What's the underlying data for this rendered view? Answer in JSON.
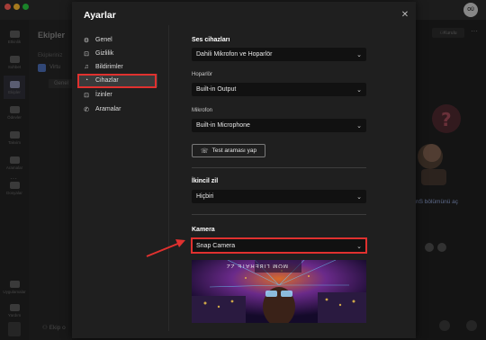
{
  "app": {
    "avatar_initials": "OÜ",
    "rail": [
      {
        "label": "Etkinlik",
        "icon": "bell-icon"
      },
      {
        "label": "Sohbet",
        "icon": "chat-icon"
      },
      {
        "label": "Ekipler",
        "icon": "teams-icon",
        "active": true
      },
      {
        "label": "Ödevler",
        "icon": "assignments-icon"
      },
      {
        "label": "Takvim",
        "icon": "calendar-icon"
      },
      {
        "label": "Aramalar",
        "icon": "phone-icon"
      },
      {
        "label": "Dosyalar",
        "icon": "files-icon"
      }
    ],
    "rail_bottom": [
      {
        "label": "Uygulamalar",
        "icon": "apps-icon"
      },
      {
        "label": "Yardım",
        "icon": "help-icon"
      }
    ],
    "teams_header": "Ekipler",
    "teams_section": "Ekipleriniz",
    "team_name": "Virtu",
    "team_channel": "Genel",
    "join_text": "Ekip o",
    "invite_label": "Kurulu",
    "bg_right_text": "nS bölümünü aç"
  },
  "dialog": {
    "title": "Ayarlar",
    "nav": [
      {
        "label": "Genel",
        "icon": "gear-icon"
      },
      {
        "label": "Gizlilik",
        "icon": "lock-icon"
      },
      {
        "label": "Bildirimler",
        "icon": "bell-icon"
      },
      {
        "label": "Cihazlar",
        "icon": "devices-icon",
        "active": true
      },
      {
        "label": "İzinler",
        "icon": "lock-icon"
      },
      {
        "label": "Aramalar",
        "icon": "phone-icon"
      }
    ],
    "audio": {
      "section_title": "Ses cihazları",
      "device_value": "Dahili Mikrofon ve Hoparlör",
      "speaker_label": "Hoparlör",
      "speaker_value": "Built-in Output",
      "mic_label": "Mikrofon",
      "mic_value": "Built-in Microphone",
      "test_button": "Test araması yap"
    },
    "secondary_ring": {
      "section_title": "İkincil zil",
      "value": "Hiçbiri"
    },
    "camera": {
      "section_title": "Kamera",
      "value": "Snap Camera",
      "preview_text": "MOM LIBERATE ZZ"
    }
  },
  "colors": {
    "highlight": "#e0312f",
    "accent": "#8a8fb0"
  }
}
